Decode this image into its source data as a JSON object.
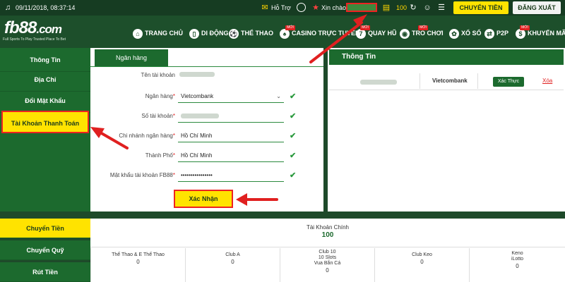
{
  "topbar": {
    "datetime": "09/11/2018, 08:37:14",
    "support": "Hỗ Trợ",
    "greeting": "Xin chào,",
    "balance": "100",
    "transfer": "CHUYỂN TIỀN",
    "logout": "ĐĂNG XUẤT"
  },
  "brand": {
    "logo_fb": "fb",
    "logo_88": "88",
    "logo_com": ".com",
    "tagline": "Full Sports To Play   Trusted Place To Bet"
  },
  "nav": [
    {
      "label": "TRANG CHỦ",
      "icon": "home-icon"
    },
    {
      "label": "DI ĐỘNG",
      "icon": "mobile-icon"
    },
    {
      "label": "THỂ THAO",
      "icon": "sports-icon"
    },
    {
      "label": "CASINO TRỰC TUYẾN",
      "icon": "casino-icon",
      "badge": "MỚI"
    },
    {
      "label": "QUAY HŨ",
      "icon": "slot-icon",
      "badge": "MỚI"
    },
    {
      "label": "TRÒ CHƠI",
      "icon": "game-icon",
      "badge": "MỚI"
    },
    {
      "label": "XỔ SỐ",
      "icon": "lottery-icon"
    },
    {
      "label": "P2P",
      "icon": "p2p-icon"
    },
    {
      "label": "KHUYẾN MÃI",
      "icon": "promo-icon",
      "badge": "MỚI"
    }
  ],
  "sidebar": [
    {
      "label": "Thông Tin"
    },
    {
      "label": "Địa Chỉ"
    },
    {
      "label": "Đổi Mật Khẩu"
    },
    {
      "label": "Tài Khoản Thanh Toán"
    }
  ],
  "form": {
    "tab": "Ngân hàng",
    "fields": [
      {
        "label": "Tên tài khoản",
        "value": ""
      },
      {
        "label": "Ngân hàng",
        "value": "Vietcombank"
      },
      {
        "label": "Số tài khoản",
        "value": ""
      },
      {
        "label": "Chi nhánh ngân hàng",
        "value": "Hồ Chí Minh"
      },
      {
        "label": "Thành Phố",
        "value": "Hồ Chí Minh"
      },
      {
        "label": "Mật khẩu tài khoản FB88",
        "value": "••••••••••••••••"
      }
    ],
    "required_mark": "*",
    "confirm": "Xác Nhận"
  },
  "info": {
    "title": "Thông Tin",
    "bank": "Vietcombank",
    "verify": "Xác Thực",
    "delete": "Xóa"
  },
  "bottom": {
    "menu": [
      {
        "label": "Chuyển Tiền"
      },
      {
        "label": "Chuyển Quỹ"
      },
      {
        "label": "Rút Tiền"
      }
    ],
    "main_account_label": "Tài Khoản Chính",
    "main_account_value": "100",
    "wallets": [
      {
        "name": "Thể Thao & E Thể Thao",
        "value": "0"
      },
      {
        "name": "Club A",
        "value": "0"
      },
      {
        "name": "Club 10\n10 Slots\nVua Bắn Cá",
        "value": "0"
      },
      {
        "name": "Club Keo",
        "value": "0"
      },
      {
        "name": "Keno\niLotto",
        "value": "0"
      }
    ]
  },
  "colors": {
    "brand_green": "#1c6a2e",
    "accent_yellow": "#ffe300",
    "arrow_red": "#e02020"
  }
}
